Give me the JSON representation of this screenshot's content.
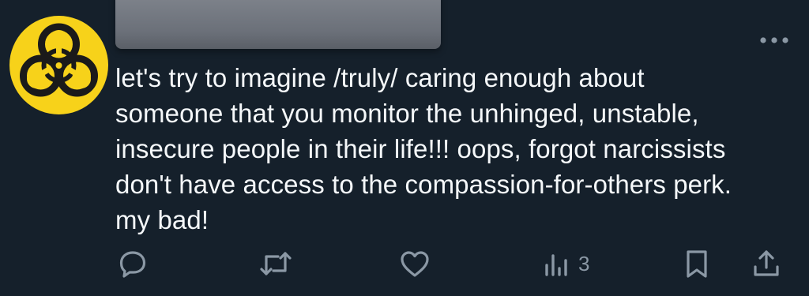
{
  "tweet": {
    "text": "let's try to imagine /truly/ caring enough about\nsomeone that you monitor the unhinged, unstable,\ninsecure people in their life!!! oops, forgot narcissists\ndon't have access to the compassion-for-others perk.\nmy bad!"
  },
  "avatar": {
    "icon": "biohazard-icon",
    "background_color": "#f7d21a",
    "symbol_color": "#1a1a1a"
  },
  "actions": {
    "reply": {
      "icon": "reply-icon"
    },
    "retweet": {
      "icon": "retweet-icon"
    },
    "like": {
      "icon": "heart-icon"
    },
    "views": {
      "icon": "analytics-icon",
      "count": "3"
    },
    "bookmark": {
      "icon": "bookmark-icon"
    },
    "share": {
      "icon": "share-icon"
    }
  },
  "colors": {
    "background": "#15202b",
    "text": "#f5f8fa",
    "icon": "#8b98a5"
  }
}
